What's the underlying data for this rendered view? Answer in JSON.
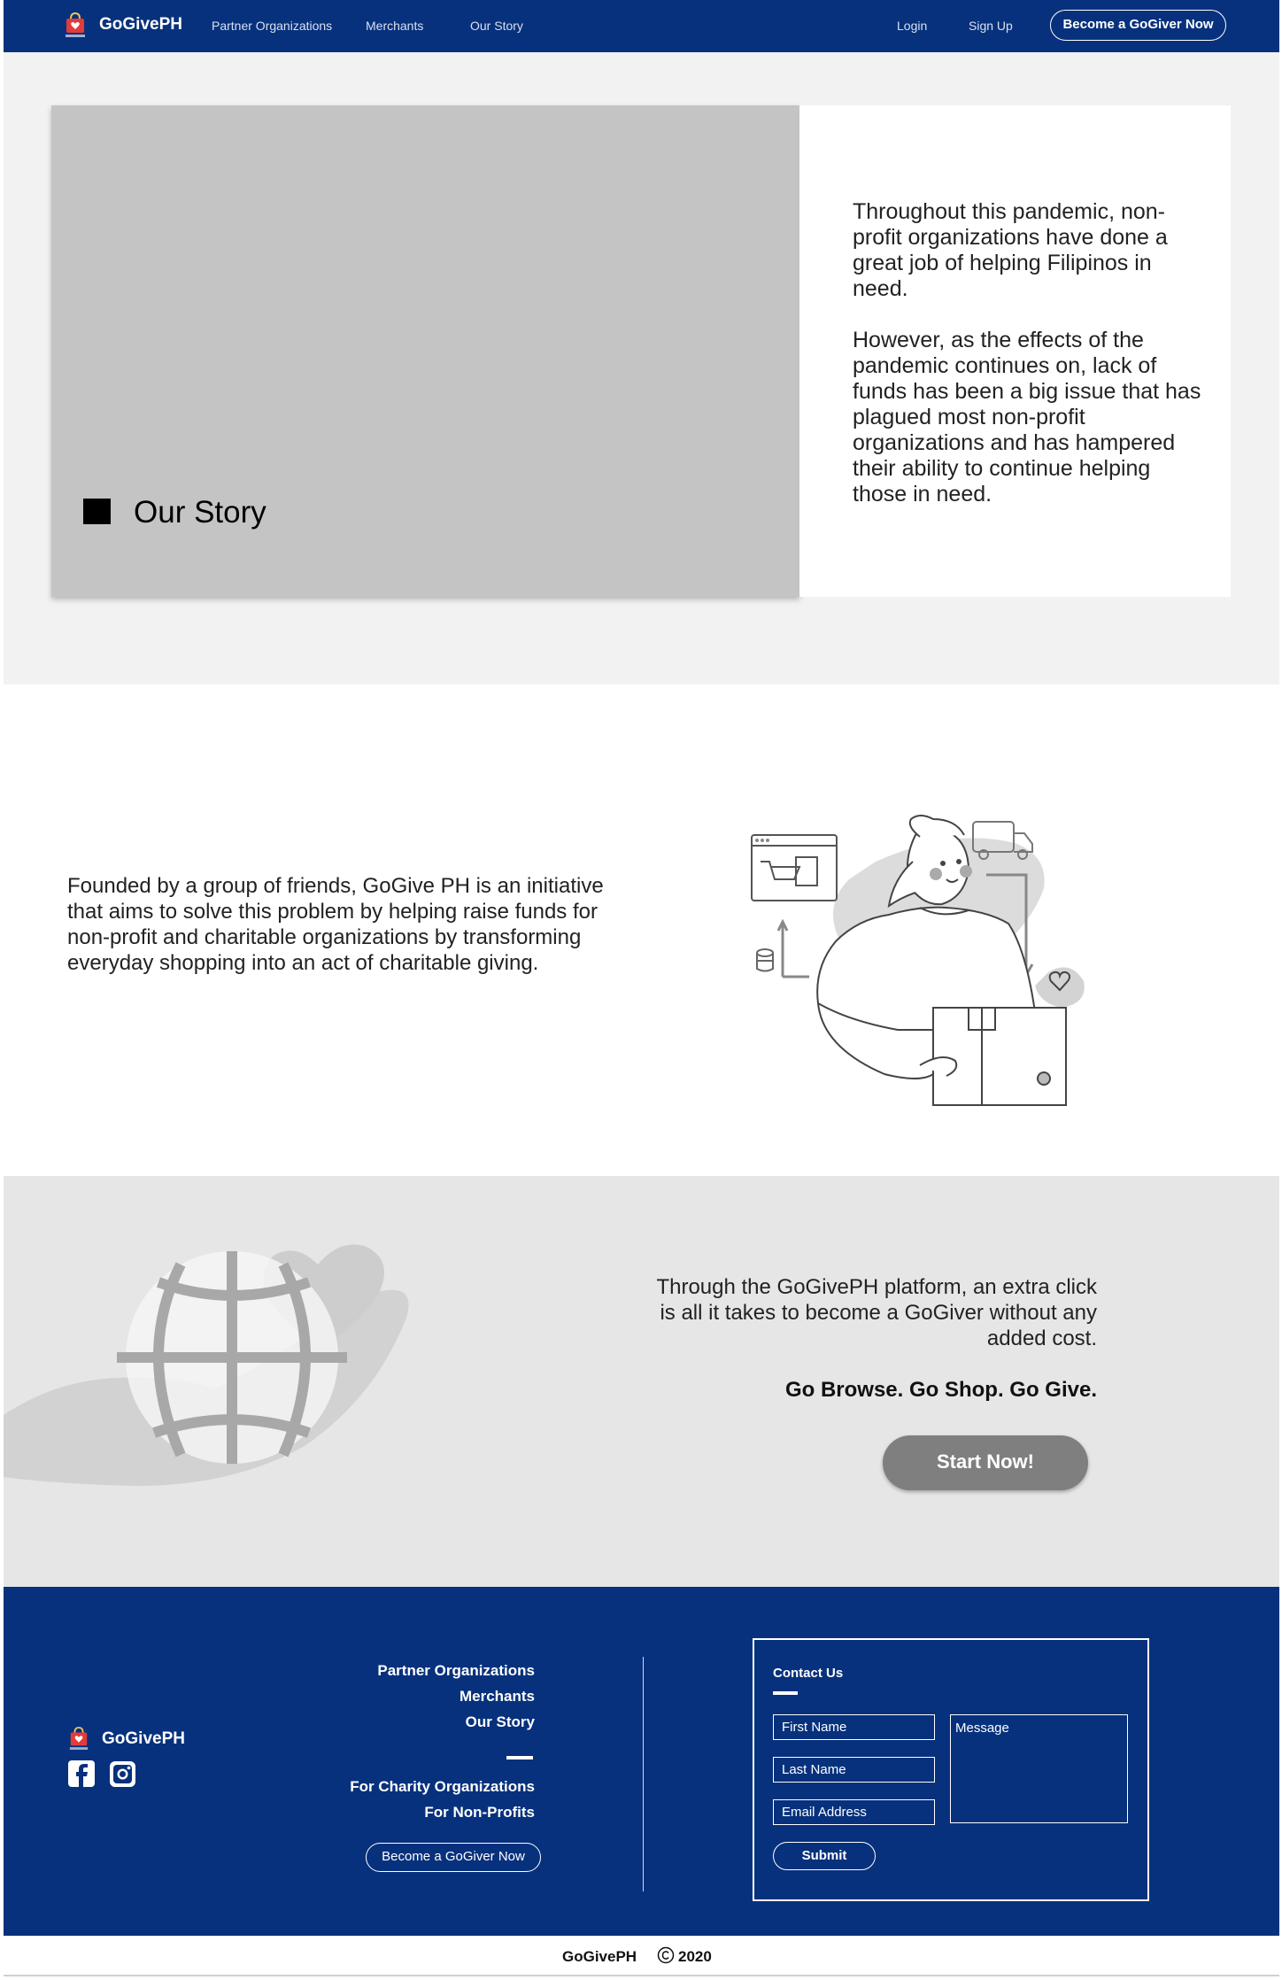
{
  "nav": {
    "brand": "GoGivePH",
    "links": [
      "Partner Organizations",
      "Merchants",
      "Our Story"
    ],
    "login": "Login",
    "signup": "Sign Up",
    "cta": "Become a GoGiver Now"
  },
  "hero": {
    "title": "Our Story",
    "paragraphs": [
      "Throughout this pandemic, non-profit organizations have done a great job of helping Filipinos in need.",
      "However, as the effects of the pandemic continues on, lack of funds has been a big issue that has plagued most non-profit organizations and has hampered their ability to continue helping those in need."
    ]
  },
  "founded": {
    "text": "Founded by a group of friends, GoGive PH is an initiative that aims to solve this problem by helping raise funds for non-profit and charitable organizations by transforming everyday shopping into an act of charitable giving."
  },
  "platform": {
    "text": "Through the GoGivePH platform, an extra click is all it takes to become a GoGiver without any added cost.",
    "tagline": "Go Browse. Go Shop. Go Give.",
    "button": "Start Now!"
  },
  "footer": {
    "brand": "GoGivePH",
    "links_main": [
      "Partner Organizations",
      "Merchants",
      "Our Story"
    ],
    "links_secondary": [
      "For Charity Organizations",
      "For Non-Profits"
    ],
    "cta": "Become a GoGiver Now",
    "contact": {
      "title": "Contact Us",
      "first_name": "First Name",
      "last_name": "Last Name",
      "email": "Email Address",
      "message": "Message",
      "submit": "Submit"
    }
  },
  "bottom": {
    "brand": "GoGivePH",
    "year": "2020"
  },
  "colors": {
    "brand_blue": "#07317c",
    "logo_red": "#e23b3b",
    "button_grey": "#7f7f7f"
  },
  "icons": [
    "shopping-bag-logo-icon",
    "facebook-icon",
    "instagram-icon",
    "copyright-icon"
  ]
}
